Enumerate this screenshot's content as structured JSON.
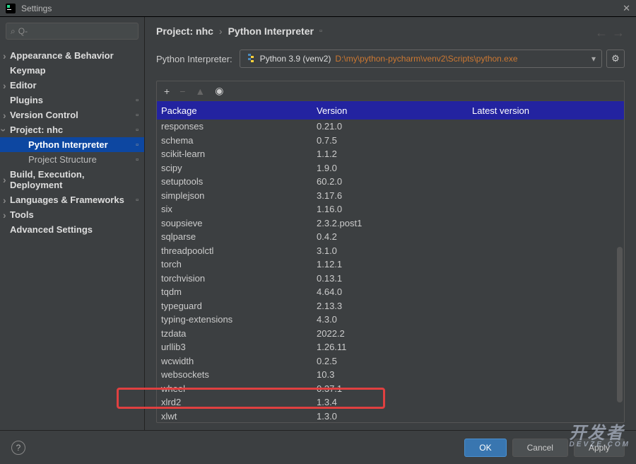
{
  "window": {
    "title": "Settings"
  },
  "search": {
    "placeholder": "Q-"
  },
  "sidebar": {
    "items": [
      {
        "label": "Appearance & Behavior",
        "bold": true,
        "arrow": true
      },
      {
        "label": "Keymap",
        "bold": true
      },
      {
        "label": "Editor",
        "bold": true,
        "arrow": true
      },
      {
        "label": "Plugins",
        "bold": true,
        "sep": true
      },
      {
        "label": "Version Control",
        "bold": true,
        "arrow": true,
        "sep": true
      },
      {
        "label": "Project: nhc",
        "bold": true,
        "arrow": true,
        "expanded": true,
        "sep": true
      },
      {
        "label": "Python Interpreter",
        "child": true,
        "selected": true,
        "sep": true
      },
      {
        "label": "Project Structure",
        "child": true,
        "sep": true
      },
      {
        "label": "Build, Execution, Deployment",
        "bold": true,
        "arrow": true
      },
      {
        "label": "Languages & Frameworks",
        "bold": true,
        "arrow": true,
        "sep": true
      },
      {
        "label": "Tools",
        "bold": true,
        "arrow": true
      },
      {
        "label": "Advanced Settings",
        "bold": true
      }
    ]
  },
  "breadcrumb": {
    "root": "Project: nhc",
    "page": "Python Interpreter"
  },
  "interpreter": {
    "label": "Python Interpreter:",
    "name": "Python 3.9 (venv2)",
    "path": "D:\\my\\python-pycharm\\venv2\\Scripts\\python.exe"
  },
  "table": {
    "headers": {
      "package": "Package",
      "version": "Version",
      "latest": "Latest version"
    },
    "rows": [
      {
        "pkg": "responses",
        "ver": "0.21.0"
      },
      {
        "pkg": "schema",
        "ver": "0.7.5"
      },
      {
        "pkg": "scikit-learn",
        "ver": "1.1.2"
      },
      {
        "pkg": "scipy",
        "ver": "1.9.0"
      },
      {
        "pkg": "setuptools",
        "ver": "60.2.0"
      },
      {
        "pkg": "simplejson",
        "ver": "3.17.6"
      },
      {
        "pkg": "six",
        "ver": "1.16.0"
      },
      {
        "pkg": "soupsieve",
        "ver": "2.3.2.post1"
      },
      {
        "pkg": "sqlparse",
        "ver": "0.4.2"
      },
      {
        "pkg": "threadpoolctl",
        "ver": "3.1.0"
      },
      {
        "pkg": "torch",
        "ver": "1.12.1"
      },
      {
        "pkg": "torchvision",
        "ver": "0.13.1"
      },
      {
        "pkg": "tqdm",
        "ver": "4.64.0"
      },
      {
        "pkg": "typeguard",
        "ver": "2.13.3"
      },
      {
        "pkg": "typing-extensions",
        "ver": "4.3.0"
      },
      {
        "pkg": "tzdata",
        "ver": "2022.2"
      },
      {
        "pkg": "urllib3",
        "ver": "1.26.11"
      },
      {
        "pkg": "wcwidth",
        "ver": "0.2.5"
      },
      {
        "pkg": "websockets",
        "ver": "10.3"
      },
      {
        "pkg": "wheel",
        "ver": "0.37.1"
      },
      {
        "pkg": "xlrd2",
        "ver": "1.3.4"
      },
      {
        "pkg": "xlwt",
        "ver": "1.3.0"
      }
    ]
  },
  "buttons": {
    "ok": "OK",
    "cancel": "Cancel",
    "apply": "Apply"
  },
  "watermark": {
    "top": "开发者",
    "bottom": "DEVZE.COM"
  }
}
